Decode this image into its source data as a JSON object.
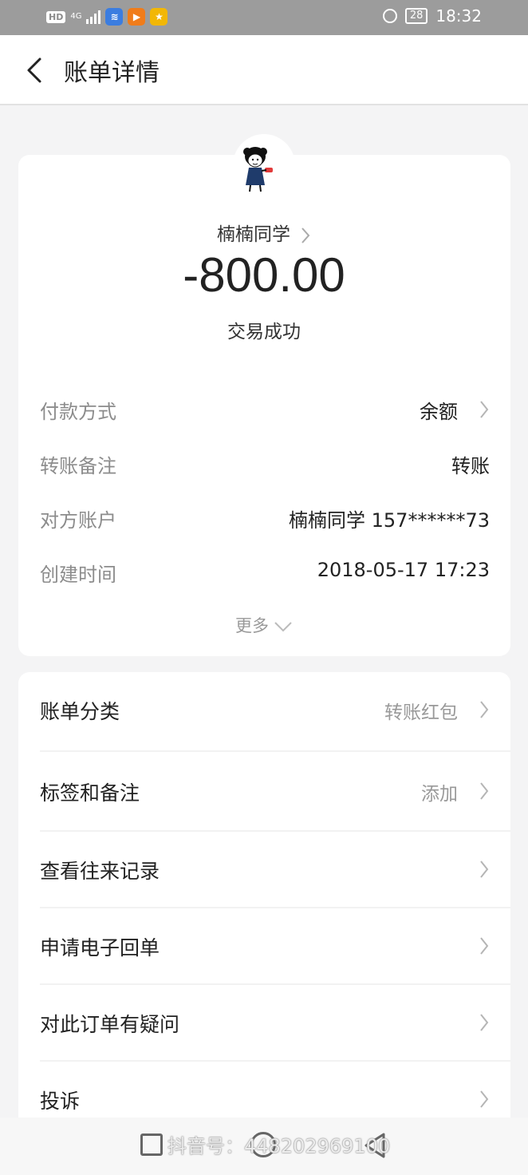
{
  "status_bar": {
    "hd": "HD",
    "network": "4G",
    "apps": [
      {
        "icon": "wifi-app-icon",
        "color": "#3b7de0",
        "glyph": "≋"
      },
      {
        "icon": "video-app-icon",
        "color": "#f07c1a",
        "glyph": "▶"
      },
      {
        "icon": "star-app-icon",
        "color": "#f2b705",
        "glyph": "★"
      }
    ],
    "battery": "28",
    "time": "18:32"
  },
  "nav": {
    "back_icon": "chevron-left-icon",
    "title": "账单详情"
  },
  "summary": {
    "payee": "楠楠同学",
    "amount": "-800.00",
    "status": "交易成功"
  },
  "details": [
    {
      "label": "付款方式",
      "value": "余额",
      "has_chevron": true
    },
    {
      "label": "转账备注",
      "value": "转账",
      "has_chevron": false
    },
    {
      "label": "对方账户",
      "value": "楠楠同学 157******73",
      "has_chevron": false
    },
    {
      "label": "创建时间",
      "value": "2018-05-17 17:23",
      "has_chevron": false
    }
  ],
  "more_label": "更多",
  "actions": [
    {
      "label": "账单分类",
      "value": "转账红包"
    },
    {
      "label": "标签和备注",
      "value": "添加"
    },
    {
      "label": "查看往来记录",
      "value": ""
    },
    {
      "label": "申请电子回单",
      "value": ""
    },
    {
      "label": "对此订单有疑问",
      "value": ""
    },
    {
      "label": "投诉",
      "value": ""
    }
  ],
  "watermark": "抖音号：448202969100",
  "colors": {
    "status_bar": "#9c9c9c",
    "background": "#f4f4f5",
    "card": "#ffffff",
    "secondary_text": "#8c8c8c"
  }
}
